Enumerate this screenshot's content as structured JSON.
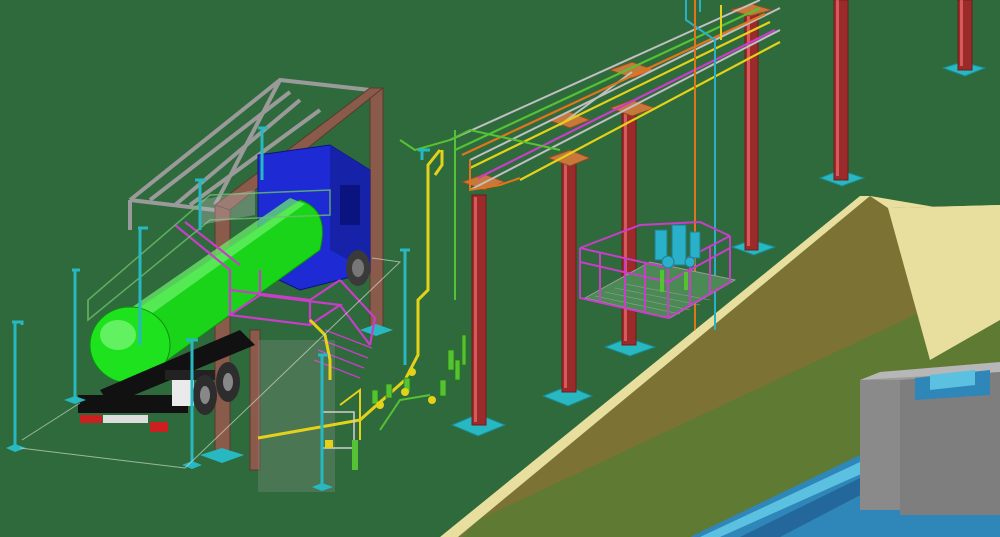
{
  "scene": {
    "colors": {
      "background": "#2f6a3c",
      "structure_steel": "#8e8e8e",
      "column_red": "#9b2a2a",
      "column_brown": "#8a5a4a",
      "footing_cyan": "#27b8c2",
      "pipe_yellow": "#e4d21a",
      "pipe_green": "#55c234",
      "pipe_cyan": "#2ab0c8",
      "pipe_orange": "#e0751c",
      "platform_magenta": "#c83ec8",
      "tank_green": "#19d419",
      "truck_cab_blue": "#1e2bd4",
      "bund_wall": "#857a3a",
      "bund_top": "#e8df9f",
      "building_grey": "#8a8a8a",
      "water_blue": "#2f86b8"
    },
    "objects": [
      {
        "name": "tanker-truck",
        "icon": "tanker-truck-icon"
      },
      {
        "name": "loading-gantry",
        "icon": "gantry-icon"
      },
      {
        "name": "pipe-rack",
        "icon": "pipe-rack-icon"
      },
      {
        "name": "pump-skid",
        "icon": "pump-skid-icon"
      },
      {
        "name": "bund-retaining-wall",
        "icon": "wall-icon"
      },
      {
        "name": "outlet-structure",
        "icon": "building-icon"
      }
    ]
  }
}
